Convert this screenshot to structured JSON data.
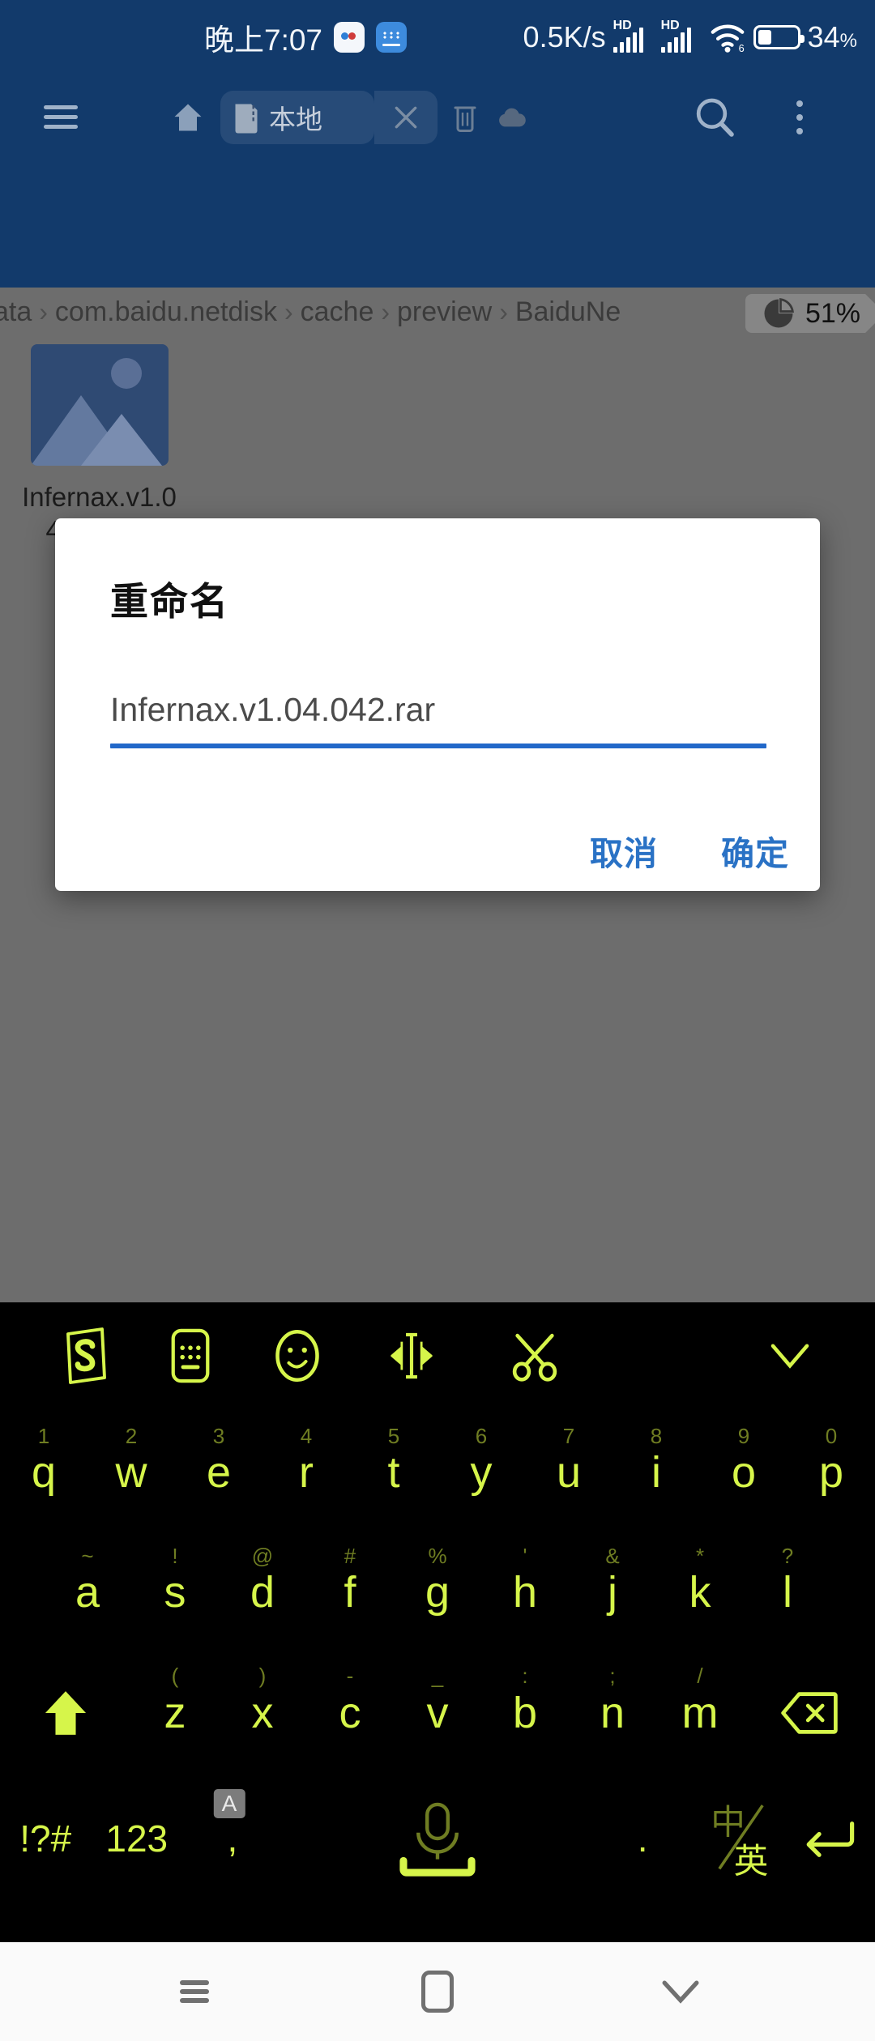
{
  "status_bar": {
    "clock": "晚上7:07",
    "net_speed": "0.5K/s",
    "signal_label": "HD",
    "battery_percent": "34",
    "battery_unit": "%",
    "battery_level": 34,
    "icons": [
      "baidu-notification-icon",
      "keyboard-notification-icon",
      "hd-signal-icon",
      "hd-signal-icon",
      "wifi6-icon",
      "battery-icon"
    ],
    "bg_color": "#123a6b"
  },
  "toolbar": {
    "menu_icon": "hamburger-icon",
    "home_icon": "home-icon",
    "tab_label": "本地",
    "tab_icon": "sdcard-icon",
    "tab_close_icon": "close-icon",
    "trash_icon": "trash-icon",
    "cloud_icon": "cloud-icon",
    "search_icon": "search-icon",
    "more_icon": "more-vertical-icon"
  },
  "breadcrumb": {
    "crumbs": [
      "ata",
      "com.baidu.netdisk",
      "cache",
      "preview",
      "BaiduNe"
    ],
    "separator": "›"
  },
  "storage": {
    "percent_label": "51%",
    "percent_value": 51,
    "icon": "pie-chart-icon"
  },
  "files": [
    {
      "name": "Infernax.v1.04.042.rar",
      "icon": "image-thumbnail-icon"
    }
  ],
  "dialog": {
    "title": "重命名",
    "input_value": "Infernax.v1.04.042.rar",
    "input_placeholder": "Infernax.v1.04.042.rar",
    "cancel_label": "取消",
    "confirm_label": "确定",
    "accent_color": "#2268c9",
    "button_color": "#2a72c5"
  },
  "keyboard": {
    "accent_color": "#d6f54a",
    "bg_color": "#000000",
    "toolbar_icons": [
      "sogou-logo-icon",
      "keyboard-settings-icon",
      "emoji-icon",
      "cursor-move-icon",
      "scissors-clipboard-icon",
      "collapse-keyboard-icon"
    ],
    "row1": [
      {
        "key": "q",
        "alt": "1"
      },
      {
        "key": "w",
        "alt": "2"
      },
      {
        "key": "e",
        "alt": "3"
      },
      {
        "key": "r",
        "alt": "4"
      },
      {
        "key": "t",
        "alt": "5"
      },
      {
        "key": "y",
        "alt": "6"
      },
      {
        "key": "u",
        "alt": "7"
      },
      {
        "key": "i",
        "alt": "8"
      },
      {
        "key": "o",
        "alt": "9"
      },
      {
        "key": "p",
        "alt": "0"
      }
    ],
    "row2": [
      {
        "key": "a",
        "alt": "~"
      },
      {
        "key": "s",
        "alt": "!"
      },
      {
        "key": "d",
        "alt": "@"
      },
      {
        "key": "f",
        "alt": "#"
      },
      {
        "key": "g",
        "alt": "%"
      },
      {
        "key": "h",
        "alt": "'"
      },
      {
        "key": "j",
        "alt": "&"
      },
      {
        "key": "k",
        "alt": "*"
      },
      {
        "key": "l",
        "alt": "?"
      }
    ],
    "row3": [
      {
        "key": "z",
        "alt": "("
      },
      {
        "key": "x",
        "alt": ")"
      },
      {
        "key": "c",
        "alt": "-"
      },
      {
        "key": "v",
        "alt": "_"
      },
      {
        "key": "b",
        "alt": ":"
      },
      {
        "key": "n",
        "alt": ";"
      },
      {
        "key": "m",
        "alt": "/"
      }
    ],
    "shift_icon": "shift-up-arrow-icon",
    "backspace_icon": "backspace-icon",
    "row4": {
      "symbols_label": "!?#",
      "numbers_label": "123",
      "comma_label": ",",
      "comma_badge": "A",
      "space_icon": "microphone-space-icon",
      "period_label": ".",
      "lang_cn": "中",
      "lang_en": "英",
      "enter_icon": "enter-return-icon"
    }
  },
  "nav_bar": {
    "recents_icon": "recents-icon",
    "home_icon": "home-square-icon",
    "back_icon": "collapse-chevron-down-icon"
  }
}
